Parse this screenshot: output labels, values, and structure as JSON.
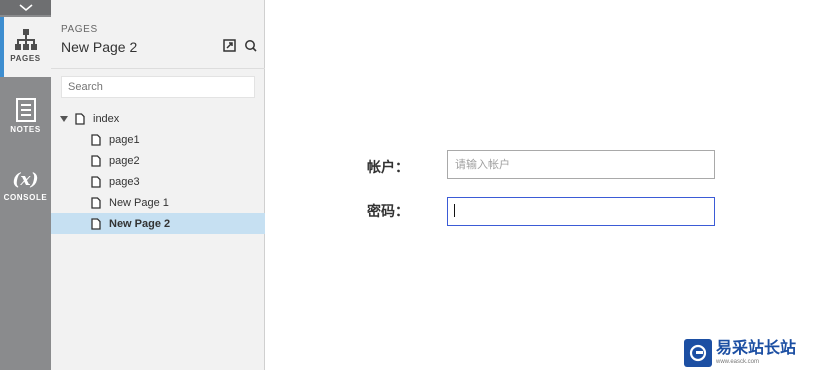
{
  "rail": {
    "pages_label": "PAGES",
    "notes_label": "NOTES",
    "console_label": "CONSOLE",
    "console_glyph": "(x)"
  },
  "panel": {
    "kicker": "PAGES",
    "title": "New Page 2",
    "search_placeholder": "Search",
    "tree": {
      "root": "index",
      "children": [
        "page1",
        "page2",
        "page3",
        "New Page 1",
        "New Page 2"
      ],
      "selected": "New Page 2"
    }
  },
  "form": {
    "account_label": "帐户：",
    "account_placeholder": "请输入帐户",
    "password_label": "密码：",
    "password_value": ""
  },
  "watermark": {
    "text": "易采站长站",
    "subtext": "www.easck.com"
  },
  "colors": {
    "rail": "#8a8b8d",
    "panel": "#f2f2f2",
    "selected": "#c6e0f2",
    "accent": "#3e8ed0",
    "focus_border": "#3b5bd6",
    "watermark": "#1c4fa3"
  }
}
